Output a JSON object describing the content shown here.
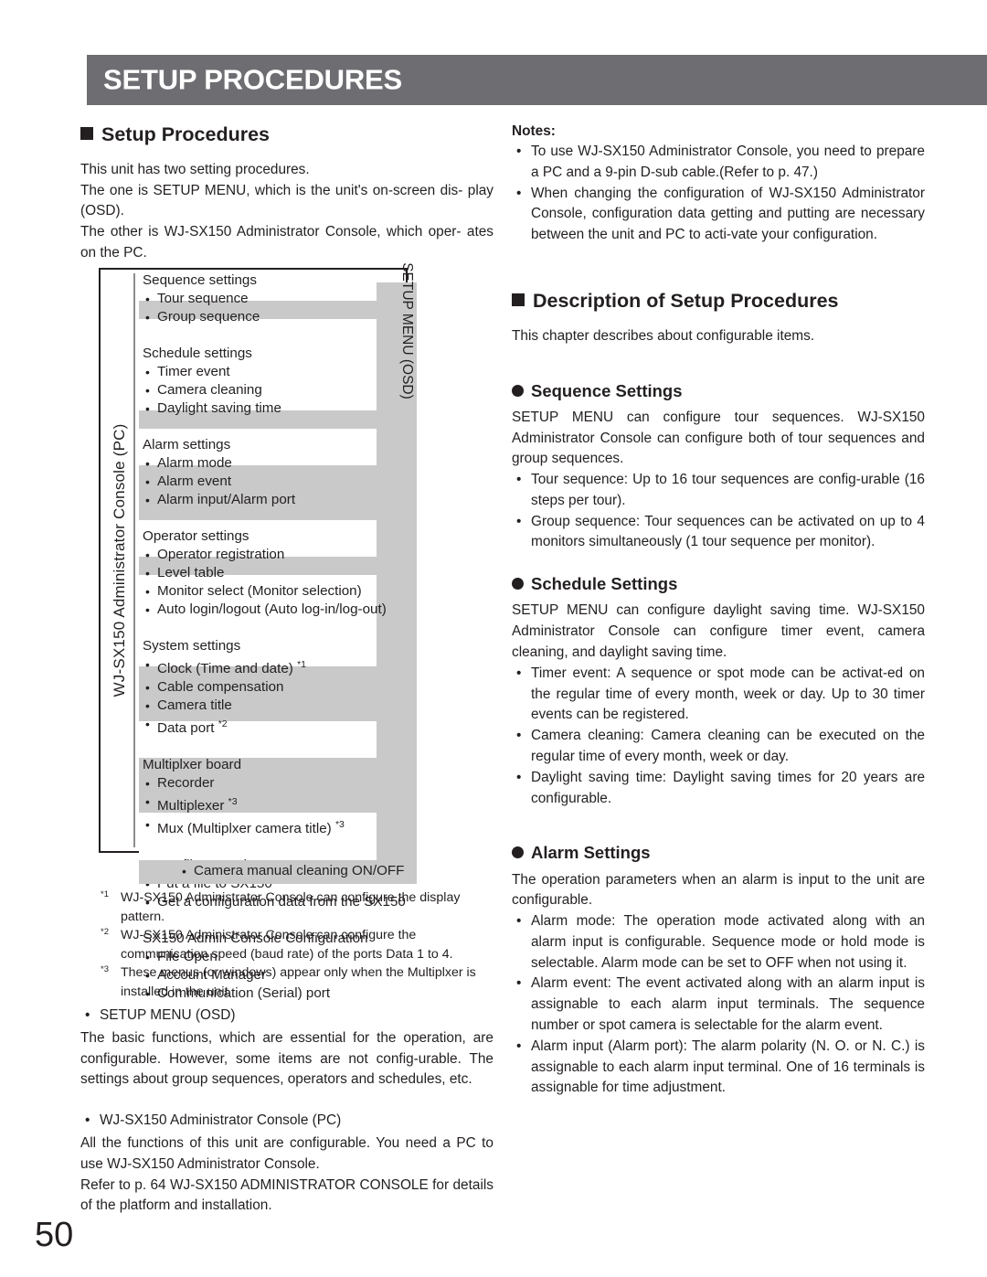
{
  "banner": {
    "title": "SETUP PROCEDURES"
  },
  "page": {
    "number": "50"
  },
  "left": {
    "heading": "Setup Procedures",
    "paragraphs": [
      "This unit has two setting procedures.",
      "The one is SETUP MENU, which is the unit's on-screen dis-play (OSD).",
      "The other is WJ-SX150 Administrator Console, which oper-ates on the PC."
    ],
    "para1": "This unit has two setting procedures.",
    "para2": "The one is SETUP MENU, which is the unit's on-screen dis- play (OSD).",
    "para3": "The other is WJ-SX150 Administrator Console, which oper- ates on the PC."
  },
  "diagram": {
    "left_axis_label": "WJ-SX150 Administrator Console (PC)",
    "right_axis_label": "SETUP MENU (OSD)",
    "groups": [
      {
        "title": "Sequence settings",
        "items": [
          "Tour sequence",
          "Group sequence"
        ]
      },
      {
        "title": "Schedule settings",
        "items": [
          "Timer event",
          "Camera cleaning",
          "Daylight saving time"
        ]
      },
      {
        "title": "Alarm settings",
        "items": [
          "Alarm mode",
          "Alarm event",
          "Alarm input/Alarm port"
        ]
      },
      {
        "title": "Operator settings",
        "items": [
          "Operator registration",
          "Level table",
          "Monitor select (Monitor selection)",
          "Auto login/logout (Auto log-in/log-out)"
        ]
      },
      {
        "title": "System settings",
        "items": [
          "Clock (Time and date) *1",
          "Cable compensation",
          "Camera title",
          "Data port *2"
        ]
      },
      {
        "title": "Multiplxer board",
        "items": [
          "Recorder",
          "Multiplexer *3",
          "Mux (Multiplxer camera title) *3"
        ]
      },
      {
        "title": "Setup file operation",
        "items": [
          "Put a file to SX150",
          "Get a configuration data from the SX150"
        ]
      },
      {
        "title": "SX150 Admin Console Configuration",
        "items": [
          "File Open",
          "Account Manager",
          "Communication (Serial) port"
        ]
      }
    ],
    "bottom_item": "Camera manual cleaning ON/OFF"
  },
  "footnotes": [
    {
      "marker": "*1",
      "text": "WJ-SX150 Administrator Console can configure the display pattern."
    },
    {
      "marker": "*2",
      "text": "WJ-SX150 Administrator Console can configure the communication speed (baud rate) of the ports Data 1 to 4."
    },
    {
      "marker": "*3",
      "text": "These menus (or windows) appear only when the Multiplxer is installed in the unit."
    }
  ],
  "lower_left": {
    "bullet1": "SETUP MENU (OSD)",
    "para1": "The basic functions, which are essential for the operation, are configurable. However, some items are not config-urable. The settings about group sequences, operators and schedules, etc.",
    "bullet2": "WJ-SX150 Administrator Console (PC)",
    "para2": "All the functions of this unit are configurable. You need a PC to use WJ-SX150 Administrator Console.",
    "para3": "Refer to p. 64 WJ-SX150 ADMINISTRATOR CONSOLE for details of the platform and installation."
  },
  "right": {
    "notes_label": "Notes:",
    "notes": [
      "To use WJ-SX150 Administrator Console, you need to prepare a PC and a 9-pin D-sub cable.(Refer to p. 47.)",
      "When changing the configuration of WJ-SX150 Administrator Console, configuration data getting and putting are necessary between the unit and PC to acti-vate your configuration."
    ],
    "desc_heading": "Description of Setup Procedures",
    "desc_intro": "This chapter describes about configurable items.",
    "sections": [
      {
        "heading": "Sequence Settings",
        "intro": "SETUP MENU can configure tour sequences. WJ-SX150 Administrator Console can configure both of tour sequences and group sequences.",
        "bullets": [
          "Tour sequence: Up to 16 tour sequences are config-urable (16 steps per tour).",
          "Group sequence: Tour sequences can be activated on up to 4 monitors simultaneously (1 tour sequence per monitor)."
        ]
      },
      {
        "heading": "Schedule Settings",
        "intro": "SETUP MENU can configure daylight saving time. WJ-SX150 Administrator Console can configure timer event, camera cleaning, and daylight saving time.",
        "bullets": [
          "Timer event: A sequence or spot mode can be activat-ed on the regular time of every month, week or day. Up to 30 timer events can be registered.",
          "Camera cleaning: Camera cleaning can be executed on the regular time of every month, week or day.",
          "Daylight saving time: Daylight saving times for 20 years are configurable."
        ]
      },
      {
        "heading": "Alarm Settings",
        "intro": "The operation parameters when an alarm is input to the unit are configurable.",
        "bullets": [
          "Alarm mode: The  operation mode activated along with an alarm input is configurable. Sequence mode or hold mode is selectable. Alarm mode can be set to OFF when not using it.",
          "Alarm event: The event activated along with an alarm input is assignable to each alarm input terminals. The sequence number or spot camera is selectable for the alarm event.",
          "Alarm input (Alarm port): The alarm polarity (N. O. or N. C.) is assignable to each alarm input terminal. One of 16 terminals is assignable for time adjustment."
        ]
      }
    ]
  }
}
